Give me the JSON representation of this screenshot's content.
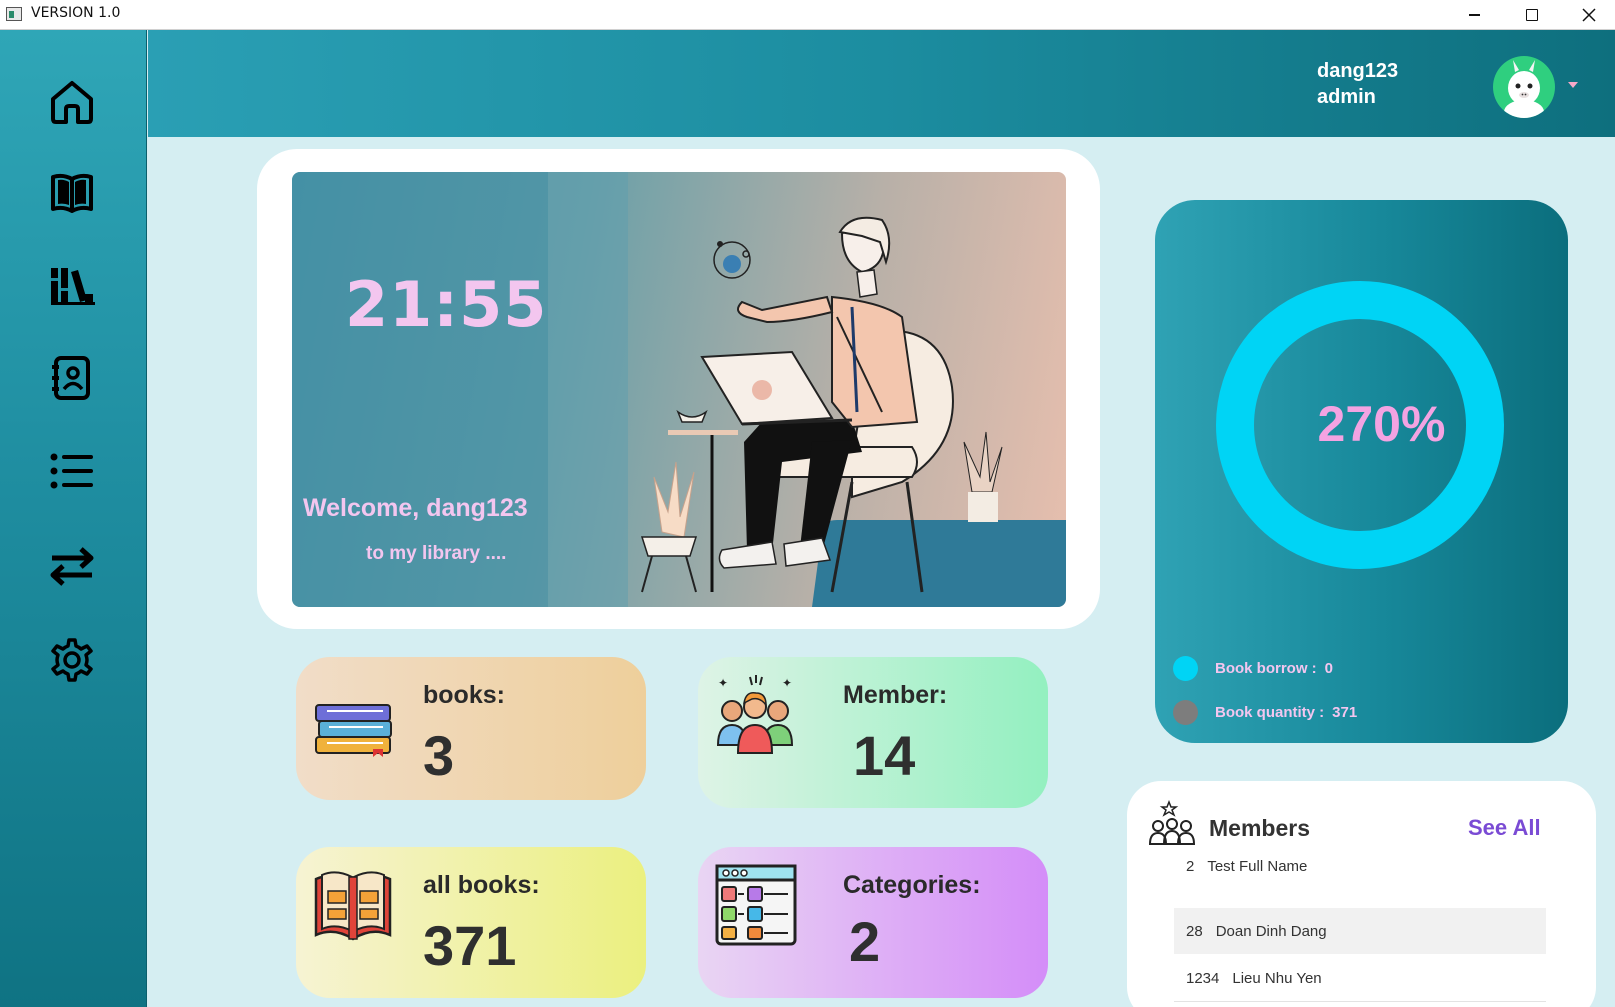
{
  "window": {
    "title": "VERSION 1.0"
  },
  "sidebar": {
    "items": [
      {
        "name": "home",
        "icon": "home-icon"
      },
      {
        "name": "books",
        "icon": "book-open-icon"
      },
      {
        "name": "library",
        "icon": "bookshelf-icon"
      },
      {
        "name": "contacts",
        "icon": "contact-book-icon"
      },
      {
        "name": "list",
        "icon": "list-icon"
      },
      {
        "name": "transfer",
        "icon": "arrows-exchange-icon"
      },
      {
        "name": "settings",
        "icon": "gear-icon"
      }
    ]
  },
  "header": {
    "username": "dang123",
    "role": "admin",
    "avatar_icon": "llama-avatar"
  },
  "hero": {
    "time": "21:55",
    "welcome": "Welcome, dang123",
    "subtitle": "to my library ...."
  },
  "stats": {
    "books": {
      "label": "books:",
      "value": "3"
    },
    "members": {
      "label": "Member:",
      "value": "14"
    },
    "all_books": {
      "label": "all books:",
      "value": "371"
    },
    "categories": {
      "label": "Categories:",
      "value": "2"
    }
  },
  "donut": {
    "percent_text": "270%",
    "ring_color": "#00d4f5",
    "legend": [
      {
        "label": "Book borrow :",
        "value": "0",
        "color": "#00d4f5"
      },
      {
        "label": "Book quantity :",
        "value": "371",
        "color": "#7d7d7d"
      }
    ]
  },
  "members_panel": {
    "title": "Members",
    "see_all": "See All",
    "rows": [
      {
        "id": "2",
        "name": "Test Full Name"
      },
      {
        "id": "28",
        "name": "Doan Dinh Dang"
      },
      {
        "id": "1234",
        "name": "Lieu Nhu Yen"
      }
    ]
  },
  "colors": {
    "accent_pink": "#f3c6ef",
    "teal": "#1c8da0",
    "purple": "#7a4bd4"
  }
}
